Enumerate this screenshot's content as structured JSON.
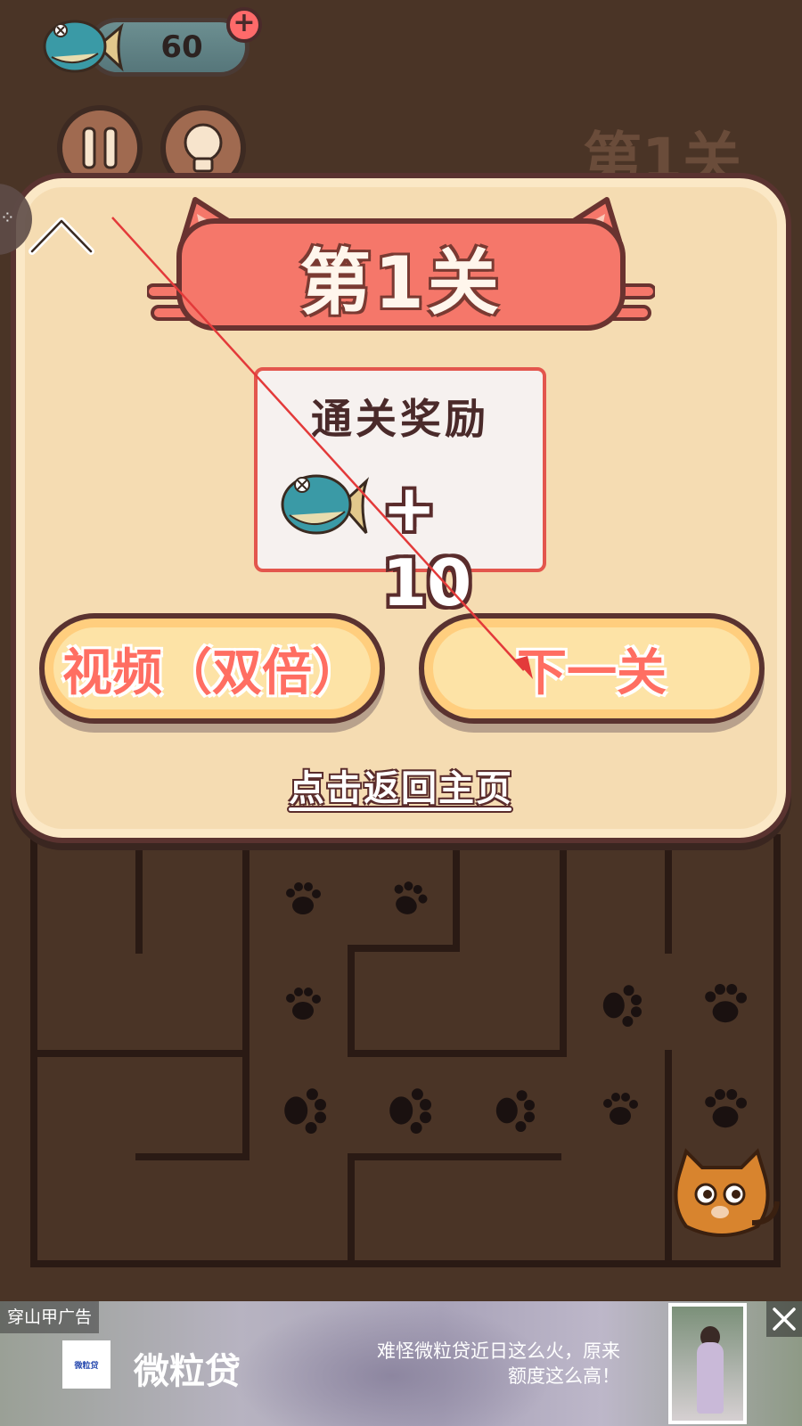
{
  "hud": {
    "coin_count": "60",
    "plus_label": "+",
    "level_title_bg": "第1关"
  },
  "dialog": {
    "level_title": "第1关",
    "reward_title": "通关奖励",
    "reward_amount": "+ 10",
    "video_button": "视频（双倍）",
    "next_button": "下一关",
    "home_link": "点击返回主页"
  },
  "ad": {
    "tag": "穿山甲广告",
    "logo_text": "微粒贷",
    "brand": "微粒贷",
    "copy_line1": "难怪微粒贷近日这么火，原来",
    "copy_line2": "额度这么高！"
  },
  "colors": {
    "background": "#4a3426",
    "dialog_fill": "#f5dcb2",
    "ribbon": "#f5776a",
    "button_text": "#ff6e62",
    "annotation_arrow": "#e33a3a"
  },
  "icons": [
    "fish-icon",
    "pause-icon",
    "bulb-icon",
    "collapse-up-icon",
    "paw-icon",
    "cat-icon",
    "close-icon"
  ]
}
